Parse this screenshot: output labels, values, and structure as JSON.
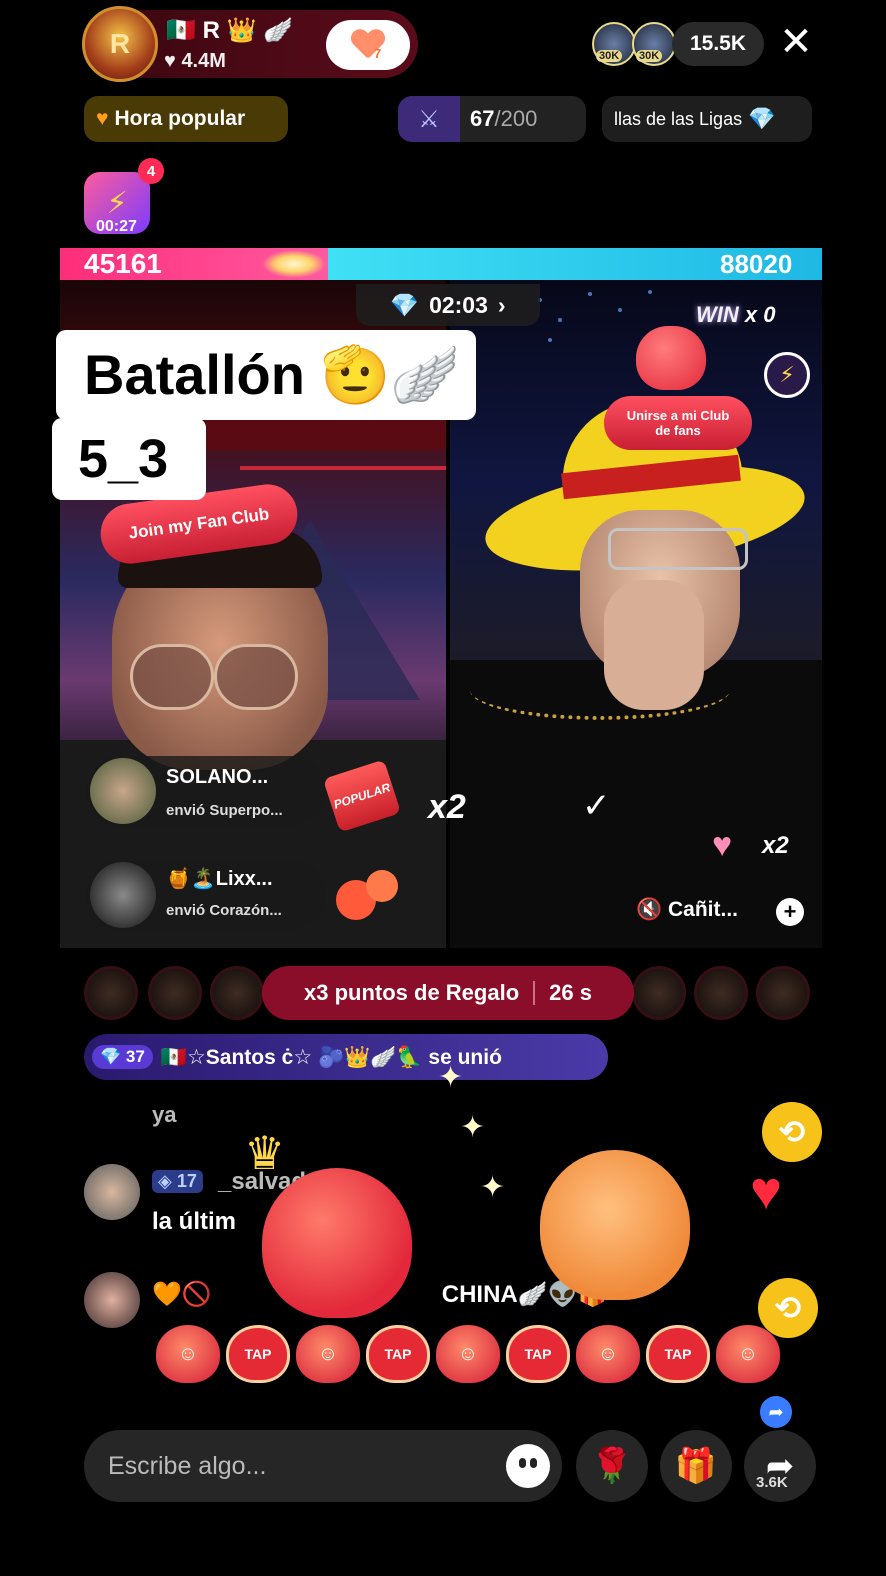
{
  "host": {
    "name": "R",
    "likes": "4.4M",
    "avatar_letter": "R",
    "follow_count": "7"
  },
  "viewers": {
    "badge_1": "30K",
    "badge_2": "30K",
    "count": "15.5K"
  },
  "top_row": {
    "hora_label": "Hora popular",
    "score_value": "67",
    "score_total": "/200",
    "liga_label": "llas de las Ligas"
  },
  "bolt": {
    "badge": "4",
    "timer": "00:27"
  },
  "battle": {
    "left_score": "45161",
    "right_score": "88020",
    "timer": "02:03",
    "win_label": "WIN",
    "win_count": "x 0"
  },
  "caption": {
    "line1": "Batallón 🫡🪽",
    "line2": "5_3"
  },
  "left_video": {
    "fan_club_label": "Join my Fan Club"
  },
  "right_video": {
    "fan_club_line1": "Unirse a mi Club",
    "fan_club_line2": "de fans",
    "mute_label": "Cañit...",
    "multiplier": "x2"
  },
  "gifts": [
    {
      "name": "SOLANO...",
      "desc": "envió Superpo...",
      "badge": "POPULAR",
      "multiplier": "x2"
    },
    {
      "name": "🍯🏝️Lixx...",
      "desc": "envió Corazón..."
    }
  ],
  "points_banner": {
    "label": "x3 puntos de Regalo",
    "time": "26 s"
  },
  "joined": {
    "level": "37",
    "text": "🇲🇽☆Santos ċ☆ 🫐👑🪽🦜 se unió"
  },
  "chat": [
    {
      "text": "ya"
    },
    {
      "level": "17",
      "user": "_salvad 502",
      "text": "la últim"
    },
    {
      "text": "🧡🚫",
      "tail": "CHINA🪽👽🎁"
    }
  ],
  "tap_row": [
    "face",
    "TAP",
    "face",
    "TAP",
    "face",
    "TAP",
    "face",
    "TAP",
    "face"
  ],
  "bottom": {
    "input_placeholder": "Escribe algo...",
    "share_count": "3.6K"
  }
}
